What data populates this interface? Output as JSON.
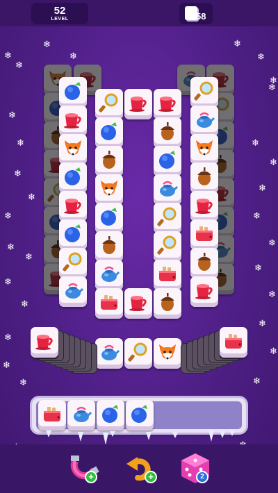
{
  "header": {
    "level_number": "52",
    "level_label": "LEVEL",
    "remaining_tiles": "58"
  },
  "board": {
    "open_tiles": [
      "magnifier",
      "cup",
      "cup",
      "blueberry",
      "acorn",
      "acorn",
      "blueberry",
      "fox",
      "kettle",
      "blueberry",
      "magnifier",
      "acorn",
      "magnifier",
      "kettle",
      "toaster",
      "toaster",
      "cup",
      "acorn"
    ],
    "side_stack_left_top": "cup",
    "side_stack_right_top": "toaster",
    "middle_row": [
      "kettle",
      "magnifier",
      "fox"
    ]
  },
  "tray": {
    "slots_total": 7,
    "slots": [
      "toaster",
      "kettle",
      "blueberry",
      "blueberry"
    ]
  },
  "powerups": {
    "magnet": {
      "icon": "magnet-icon",
      "badge": "+"
    },
    "undo": {
      "icon": "undo-icon",
      "badge": "+"
    },
    "shuffle": {
      "icon": "dice-icon",
      "badge": "2"
    }
  },
  "colors": {
    "background": "#4e1f86",
    "tile_face": "#fbf4fa",
    "tray": "#8f82c8"
  }
}
